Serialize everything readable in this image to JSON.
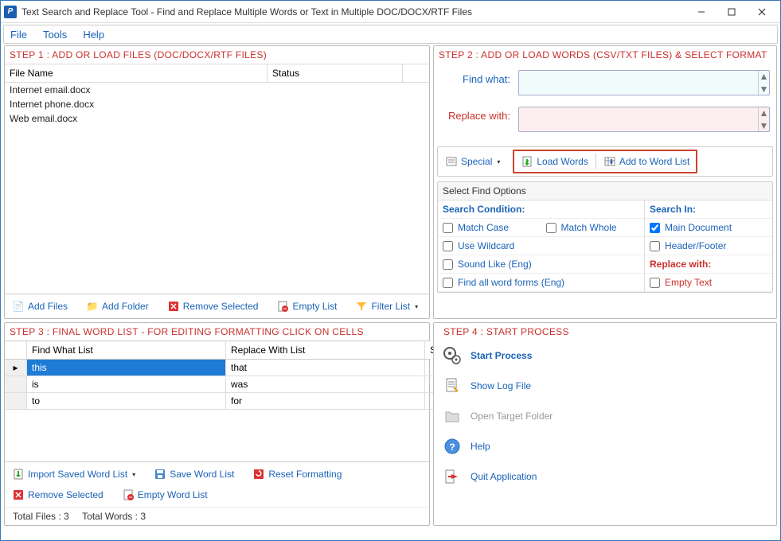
{
  "window": {
    "title": "Text Search and Replace Tool  - Find and Replace Multiple Words or Text  in Multiple DOC/DOCX/RTF Files"
  },
  "menu": {
    "file": "File",
    "tools": "Tools",
    "help": "Help"
  },
  "step1": {
    "title": "STEP 1 : ADD OR LOAD FILES (DOC/DOCX/RTF FILES)",
    "col_filename": "File Name",
    "col_status": "Status",
    "files": [
      {
        "name": "Internet email.docx"
      },
      {
        "name": "Internet phone.docx"
      },
      {
        "name": "Web email.docx"
      }
    ],
    "btn_add_files": "Add Files",
    "btn_add_folder": "Add Folder",
    "btn_remove_selected": "Remove Selected",
    "btn_empty_list": "Empty List",
    "btn_filter_list": "Filter List"
  },
  "step2": {
    "title": "STEP 2 : ADD OR LOAD WORDS (CSV/TXT FILES) & SELECT FORMAT",
    "find_what_label": "Find what:",
    "replace_with_label": "Replace with:",
    "find_value": "",
    "replace_value": "",
    "btn_special": "Special",
    "btn_load_words": "Load Words",
    "btn_add_to_word_list": "Add to Word List",
    "options_title": "Select Find Options",
    "search_condition": "Search Condition:",
    "search_in": "Search In:",
    "match_case": "Match Case",
    "match_whole": "Match Whole",
    "use_wildcard": "Use Wildcard",
    "sound_like": "Sound Like (Eng)",
    "find_all_forms": "Find all word forms (Eng)",
    "main_document": "Main Document",
    "header_footer": "Header/Footer",
    "replace_with_head": "Replace with:",
    "empty_text": "Empty Text",
    "checks": {
      "match_case": false,
      "match_whole": false,
      "use_wildcard": false,
      "sound_like": false,
      "find_all_forms": false,
      "main_document": true,
      "header_footer": false,
      "empty_text": false
    }
  },
  "step3": {
    "title": "STEP 3 : FINAL WORD LIST - FOR EDITING FORMATTING CLICK ON CELLS",
    "col_find": "Find What List",
    "col_replace": "Replace With List",
    "col_status": "Status",
    "rows": [
      {
        "find": "this",
        "replace": "that",
        "status": "",
        "selected": true
      },
      {
        "find": "is",
        "replace": "was",
        "status": "",
        "selected": false
      },
      {
        "find": "to",
        "replace": "for",
        "status": "",
        "selected": false
      }
    ],
    "btn_import": "Import Saved Word List",
    "btn_save": "Save Word List",
    "btn_reset": "Reset Formatting",
    "btn_remove": "Remove Selected",
    "btn_empty": "Empty Word List",
    "total_files_label": "Total Files :",
    "total_files": "3",
    "total_words_label": "Total Words :",
    "total_words": "3"
  },
  "step4": {
    "title": "STEP 4 : START PROCESS",
    "start_process": "Start Process",
    "show_log": "Show Log File",
    "open_target": "Open Target Folder",
    "help": "Help",
    "quit": "Quit Application"
  }
}
